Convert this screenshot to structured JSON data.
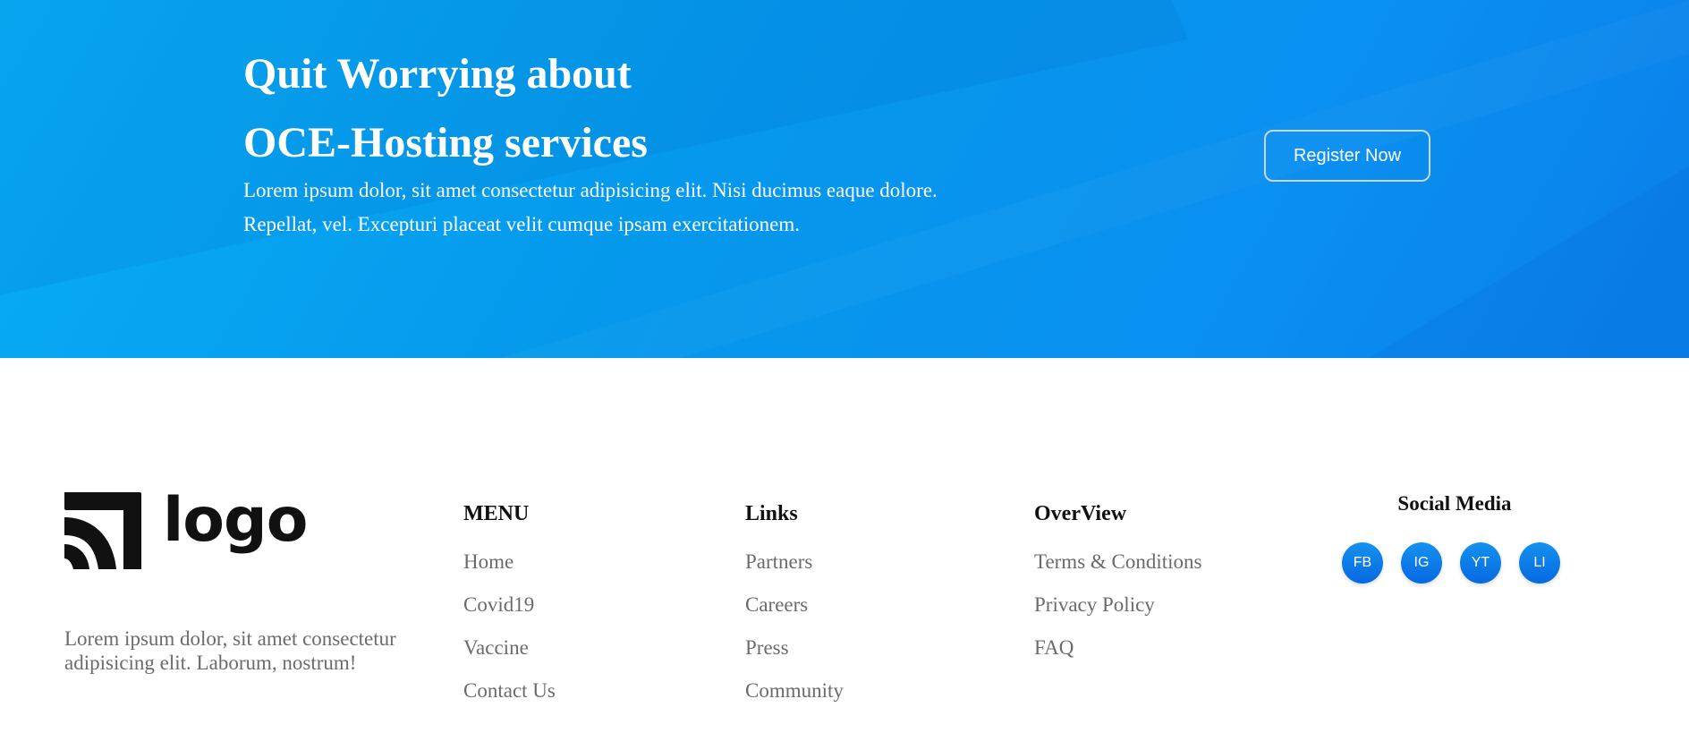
{
  "hero": {
    "title_line_1": "Quit Worrying about",
    "title_line_2": "OCE-Hosting services",
    "text": "Lorem ipsum dolor, sit amet consectetur adipisicing elit. Nisi ducimus eaque dolore. Repellat, vel. Excepturi placeat velit cumque ipsam exercitationem.",
    "register_label": "Register Now",
    "gradient_colors": [
      "#08aef5",
      "#0a7fe9"
    ]
  },
  "footer": {
    "logo_text": "logo",
    "about": "Lorem ipsum dolor, sit amet consectetur adipisicing elit. Laborum, nostrum!",
    "menu": {
      "heading": "MENU",
      "items": [
        "Home",
        "Covid19",
        "Vaccine",
        "Contact Us"
      ]
    },
    "links": {
      "heading": "Links",
      "items": [
        "Partners",
        "Careers",
        "Press",
        "Community"
      ]
    },
    "overview": {
      "heading": "OverView",
      "items": [
        "Terms & Conditions",
        "Privacy Policy",
        "FAQ"
      ]
    },
    "social": {
      "heading": "Social Media",
      "icons": [
        {
          "label": "FB",
          "icon": "facebook-icon"
        },
        {
          "label": "IG",
          "icon": "instagram-icon"
        },
        {
          "label": "YT",
          "icon": "youtube-icon"
        },
        {
          "label": "LI",
          "icon": "linkedin-icon"
        }
      ],
      "accent_color": "#0a7fe9"
    }
  }
}
